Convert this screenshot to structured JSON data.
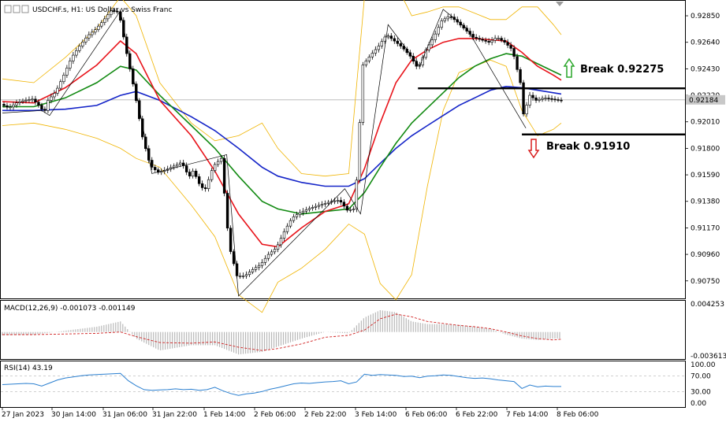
{
  "header": {
    "symbol_title": "USDCHF.s, H1:  US Dollar vs Swiss Franc"
  },
  "colors": {
    "bull_body": "#ffffff",
    "bear_body": "#000000",
    "candle_wick": "#000000",
    "ma_fast": "#e8141b",
    "ma_mid": "#128a12",
    "ma_slow": "#1424c8",
    "bollinger": "#f0b400",
    "macd_hist": "#b8b8b8",
    "macd_signal": "#d02020",
    "rsi_line": "#2a7fd0",
    "level_line": "#000000",
    "arrow_up": "#28a528",
    "arrow_down": "#d81e1e",
    "current_price_tag": "#c8c8c8"
  },
  "annotations": {
    "break_up_label": "Break 0.92275",
    "break_down_label": "Break 0.91910"
  },
  "chart_data": [
    {
      "type": "line",
      "title": "USDCHF.s, H1:  US Dollar vs Swiss Franc",
      "xlabel": "",
      "ylabel": "",
      "ylim": [
        0.9063,
        0.9295
      ],
      "yticks": [
        "0.92850",
        "0.92640",
        "0.92430",
        "0.92220",
        "0.92010",
        "0.91800",
        "0.91590",
        "0.91380",
        "0.91170",
        "0.90960",
        "0.90750"
      ],
      "current_price": "0.92184",
      "xticks": [
        "27 Jan 2023",
        "30 Jan 14:00",
        "31 Jan 06:00",
        "31 Jan 22:00",
        "1 Feb 14:00",
        "2 Feb 06:00",
        "2 Feb 22:00",
        "3 Feb 14:00",
        "6 Feb 06:00",
        "6 Feb 22:00",
        "7 Feb 14:00",
        "8 Feb 06:00"
      ],
      "levels": [
        {
          "label": "Break 0.92275",
          "value": 0.92275
        },
        {
          "label": "Break 0.91910",
          "value": 0.9191
        }
      ],
      "series": [
        {
          "kind": "price",
          "x": [
            0,
            10,
            20,
            30,
            40,
            50,
            55,
            60,
            70,
            80,
            90,
            100,
            110,
            120,
            130,
            140,
            150,
            160,
            170,
            180,
            190,
            200,
            210,
            220,
            230,
            235,
            240,
            245,
            250,
            255,
            260,
            270,
            280,
            290,
            300,
            310,
            320,
            330,
            340,
            350,
            360,
            370,
            380,
            390,
            400,
            410,
            420,
            430,
            440,
            450,
            460,
            470,
            480,
            490,
            500,
            510,
            520,
            530,
            540,
            550,
            560,
            570,
            580,
            590,
            600,
            610,
            620,
            630,
            640,
            650,
            660,
            665,
            670,
            680,
            690,
            700,
            710
          ],
          "y": [
            0.9215,
            0.9212,
            0.9216,
            0.9218,
            0.9219,
            0.9213,
            0.9208,
            0.9218,
            0.9225,
            0.9238,
            0.9252,
            0.9261,
            0.9269,
            0.9274,
            0.9281,
            0.9289,
            0.9288,
            0.9255,
            0.9225,
            0.9189,
            0.9166,
            0.9161,
            0.9163,
            0.9166,
            0.9169,
            0.9162,
            0.9158,
            0.9163,
            0.9154,
            0.9149,
            0.9148,
            0.9166,
            0.9172,
            0.9103,
            0.9079,
            0.9079,
            0.9084,
            0.9088,
            0.9096,
            0.9101,
            0.9114,
            0.9125,
            0.9129,
            0.9132,
            0.9134,
            0.9136,
            0.9138,
            0.9139,
            0.9131,
            0.9132,
            0.9246,
            0.9254,
            0.9261,
            0.927,
            0.9265,
            0.926,
            0.9253,
            0.9243,
            0.9258,
            0.9268,
            0.9281,
            0.9285,
            0.928,
            0.9274,
            0.9268,
            0.9266,
            0.9264,
            0.9268,
            0.9264,
            0.9258,
            0.9232,
            0.9201,
            0.9223,
            0.9218,
            0.922,
            0.9219,
            0.9218
          ]
        },
        {
          "kind": "ma_fast",
          "x": [
            0,
            40,
            80,
            120,
            150,
            170,
            200,
            240,
            270,
            300,
            330,
            350,
            380,
            410,
            440,
            460,
            480,
            500,
            520,
            540,
            560,
            580,
            600,
            620,
            640,
            660,
            680,
            700,
            710
          ],
          "y": [
            0.9217,
            0.9216,
            0.9228,
            0.9246,
            0.9265,
            0.9255,
            0.9218,
            0.919,
            0.9162,
            0.9128,
            0.9104,
            0.9102,
            0.9117,
            0.913,
            0.9136,
            0.9164,
            0.92,
            0.9232,
            0.925,
            0.9258,
            0.9264,
            0.9267,
            0.9267,
            0.9266,
            0.9265,
            0.9256,
            0.9245,
            0.9238,
            0.9234
          ]
        },
        {
          "kind": "ma_mid",
          "x": [
            0,
            40,
            80,
            120,
            150,
            170,
            200,
            240,
            270,
            300,
            330,
            350,
            380,
            410,
            440,
            460,
            480,
            500,
            520,
            540,
            560,
            580,
            600,
            620,
            640,
            660,
            680,
            700,
            710
          ],
          "y": [
            0.9213,
            0.9213,
            0.922,
            0.9232,
            0.9245,
            0.9242,
            0.9222,
            0.9198,
            0.918,
            0.9158,
            0.9138,
            0.9132,
            0.9128,
            0.913,
            0.9132,
            0.9145,
            0.9165,
            0.9184,
            0.92,
            0.9212,
            0.9224,
            0.9236,
            0.9245,
            0.9251,
            0.9255,
            0.9253,
            0.9247,
            0.9241,
            0.9238
          ]
        },
        {
          "kind": "ma_slow",
          "x": [
            0,
            40,
            80,
            120,
            150,
            170,
            200,
            240,
            270,
            300,
            330,
            350,
            380,
            410,
            440,
            460,
            480,
            500,
            520,
            540,
            560,
            580,
            600,
            620,
            640,
            660,
            680,
            700,
            710
          ],
          "y": [
            0.921,
            0.921,
            0.9211,
            0.9214,
            0.9222,
            0.9225,
            0.9218,
            0.9205,
            0.9194,
            0.918,
            0.9165,
            0.9158,
            0.9153,
            0.915,
            0.915,
            0.9156,
            0.9168,
            0.918,
            0.919,
            0.9198,
            0.9206,
            0.9214,
            0.922,
            0.9226,
            0.9229,
            0.9228,
            0.9226,
            0.9224,
            0.9223
          ]
        },
        {
          "kind": "bb_upper",
          "x": [
            0,
            40,
            80,
            120,
            150,
            170,
            200,
            240,
            270,
            300,
            330,
            350,
            380,
            410,
            440,
            460,
            480,
            500,
            520,
            540,
            560,
            580,
            600,
            620,
            640,
            660,
            680,
            700,
            710
          ],
          "y": [
            0.9235,
            0.9232,
            0.9252,
            0.9275,
            0.93,
            0.9285,
            0.9232,
            0.92,
            0.9186,
            0.919,
            0.92,
            0.918,
            0.916,
            0.9158,
            0.916,
            0.93,
            0.932,
            0.931,
            0.9285,
            0.9288,
            0.9292,
            0.9292,
            0.9287,
            0.9282,
            0.9282,
            0.9292,
            0.9292,
            0.9278,
            0.927
          ]
        },
        {
          "kind": "bb_lower",
          "x": [
            0,
            40,
            80,
            120,
            150,
            170,
            200,
            240,
            270,
            300,
            330,
            350,
            380,
            410,
            440,
            460,
            480,
            500,
            520,
            540,
            560,
            580,
            600,
            620,
            640,
            660,
            680,
            700,
            710
          ],
          "y": [
            0.9198,
            0.92,
            0.9195,
            0.9188,
            0.918,
            0.9172,
            0.9165,
            0.9135,
            0.911,
            0.9064,
            0.905,
            0.9074,
            0.9085,
            0.91,
            0.912,
            0.9112,
            0.9073,
            0.906,
            0.908,
            0.915,
            0.921,
            0.924,
            0.9245,
            0.925,
            0.9245,
            0.921,
            0.919,
            0.9195,
            0.92
          ]
        }
      ]
    },
    {
      "type": "bar",
      "title": "MACD(12,26,9) -0.001073 -0.001149",
      "ylim": [
        -0.003613,
        0.004253
      ],
      "yticks": [
        "0.004253",
        "-0.003613"
      ],
      "signal": {
        "x": [
          0,
          40,
          80,
          120,
          150,
          170,
          200,
          240,
          270,
          300,
          330,
          350,
          380,
          410,
          440,
          460,
          480,
          500,
          520,
          540,
          560,
          580,
          600,
          620,
          640,
          660,
          680,
          700,
          710
        ],
        "y": [
          -0.0004,
          -0.0004,
          -0.0003,
          -0.0002,
          0.0,
          -0.0007,
          -0.0016,
          -0.0017,
          -0.0015,
          -0.0023,
          -0.0028,
          -0.0025,
          -0.0018,
          -0.0008,
          -0.0005,
          0.0003,
          0.002,
          0.0027,
          0.0023,
          0.0016,
          0.0013,
          0.001,
          0.0008,
          0.0005,
          0.0,
          -0.0006,
          -0.001,
          -0.0012,
          -0.0011
        ]
      },
      "histogram": {
        "x": [
          0,
          40,
          80,
          120,
          150,
          170,
          200,
          240,
          270,
          300,
          330,
          350,
          380,
          410,
          440,
          460,
          480,
          500,
          520,
          540,
          560,
          580,
          600,
          620,
          640,
          660,
          680,
          700,
          710
        ],
        "y": [
          -0.0005,
          -0.0004,
          0.0002,
          0.0008,
          0.0016,
          -0.001,
          -0.0028,
          -0.002,
          -0.002,
          -0.0034,
          -0.003,
          -0.0022,
          -0.001,
          0.0,
          -0.0002,
          0.0022,
          0.0033,
          0.003,
          0.0016,
          0.0012,
          0.0012,
          0.0011,
          0.0008,
          0.0005,
          -0.0004,
          -0.001,
          -0.0012,
          -0.001,
          -0.001
        ]
      }
    },
    {
      "type": "line",
      "title": "RSI(14) 43.19",
      "ylim": [
        0,
        100
      ],
      "yticks": [
        "100.00",
        "70.00",
        "30.00",
        "0.00"
      ],
      "levels": [
        70,
        30
      ],
      "x": [
        0,
        10,
        20,
        30,
        40,
        50,
        60,
        70,
        80,
        90,
        100,
        110,
        120,
        130,
        140,
        150,
        160,
        170,
        180,
        190,
        200,
        210,
        220,
        230,
        240,
        250,
        260,
        270,
        280,
        290,
        300,
        310,
        320,
        330,
        340,
        350,
        360,
        370,
        380,
        390,
        400,
        410,
        420,
        430,
        440,
        450,
        460,
        470,
        480,
        490,
        500,
        510,
        520,
        530,
        540,
        550,
        560,
        570,
        580,
        590,
        600,
        610,
        620,
        630,
        640,
        650,
        660,
        670,
        680,
        690,
        700,
        710
      ],
      "y": [
        48,
        49,
        50,
        51,
        50,
        44,
        52,
        60,
        65,
        68,
        71,
        73,
        74,
        75,
        76,
        77,
        58,
        45,
        35,
        33,
        34,
        35,
        37,
        35,
        36,
        33,
        35,
        41,
        32,
        25,
        20,
        24,
        26,
        30,
        36,
        40,
        45,
        50,
        52,
        51,
        53,
        55,
        56,
        58,
        50,
        55,
        75,
        72,
        74,
        73,
        72,
        69,
        70,
        66,
        70,
        71,
        73,
        72,
        69,
        66,
        64,
        65,
        63,
        60,
        58,
        56,
        38,
        47,
        42,
        44,
        43,
        43
      ]
    }
  ]
}
